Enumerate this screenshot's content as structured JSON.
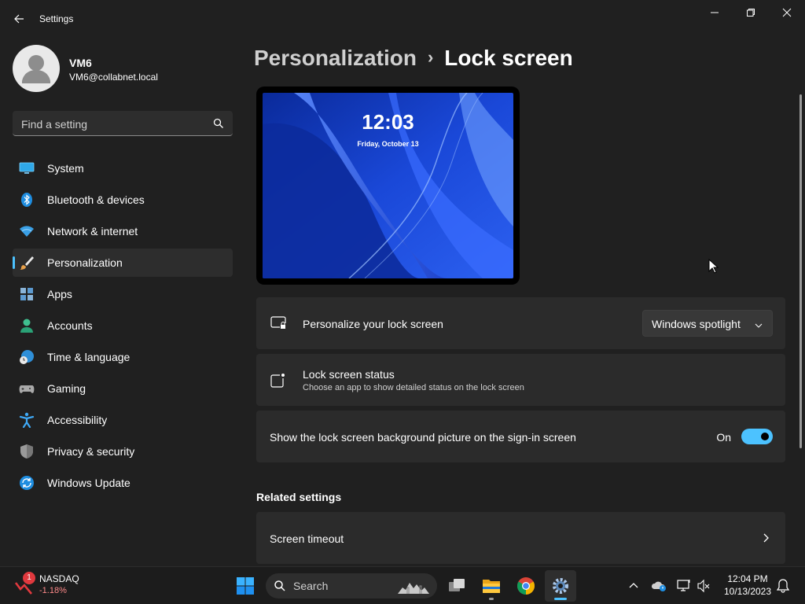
{
  "titlebar": {
    "app_title": "Settings",
    "icons": {
      "back": "back-arrow-icon",
      "minimize": "minimize-icon",
      "maximize": "restore-icon",
      "close": "close-icon"
    }
  },
  "profile": {
    "name": "VM6",
    "email": "VM6@collabnet.local"
  },
  "search": {
    "placeholder": "Find a setting"
  },
  "sidebar": {
    "active_index": 3,
    "items": [
      {
        "label": "System",
        "icon": "monitor-icon"
      },
      {
        "label": "Bluetooth & devices",
        "icon": "bluetooth-icon"
      },
      {
        "label": "Network & internet",
        "icon": "wifi-icon"
      },
      {
        "label": "Personalization",
        "icon": "paintbrush-icon"
      },
      {
        "label": "Apps",
        "icon": "apps-icon"
      },
      {
        "label": "Accounts",
        "icon": "person-icon"
      },
      {
        "label": "Time & language",
        "icon": "globe-clock-icon"
      },
      {
        "label": "Gaming",
        "icon": "gamepad-icon"
      },
      {
        "label": "Accessibility",
        "icon": "accessibility-icon"
      },
      {
        "label": "Privacy & security",
        "icon": "shield-icon"
      },
      {
        "label": "Windows Update",
        "icon": "update-icon"
      }
    ]
  },
  "main": {
    "breadcrumb_parent": "Personalization",
    "breadcrumb_current": "Lock screen",
    "preview": {
      "time": "12:03",
      "date": "Friday, October 13"
    },
    "settings": {
      "personalize": {
        "label": "Personalize your lock screen",
        "value": "Windows spotlight",
        "icon": "lock-screen-icon"
      },
      "status": {
        "title": "Lock screen status",
        "description": "Choose an app to show detailed status on the lock screen",
        "icon": "status-app-icon"
      },
      "signin_bg": {
        "label": "Show the lock screen background picture on the sign-in screen",
        "state": "On",
        "checked": true
      }
    },
    "related_heading": "Related settings",
    "related": [
      {
        "label": "Screen timeout"
      }
    ]
  },
  "taskbar": {
    "widget": {
      "name": "NASDAQ",
      "change": "-1.18%",
      "badge": "1",
      "icon": "stock-down-icon"
    },
    "search_placeholder": "Search",
    "apps": [
      "windows-start-icon",
      "search-icon",
      "task-view-icon",
      "file-explorer-icon",
      "chrome-icon",
      "settings-gear-icon"
    ],
    "tray_icons": [
      "chevron-up-icon",
      "onedrive-icon",
      "network-icon",
      "volume-muted-icon"
    ],
    "time": "12:04 PM",
    "date": "10/13/2023",
    "notification_icon": "bell-icon"
  },
  "colors": {
    "accent": "#4cc2ff",
    "background": "#202020",
    "card": "#2b2b2b",
    "taskbar": "#1c1c1c"
  }
}
